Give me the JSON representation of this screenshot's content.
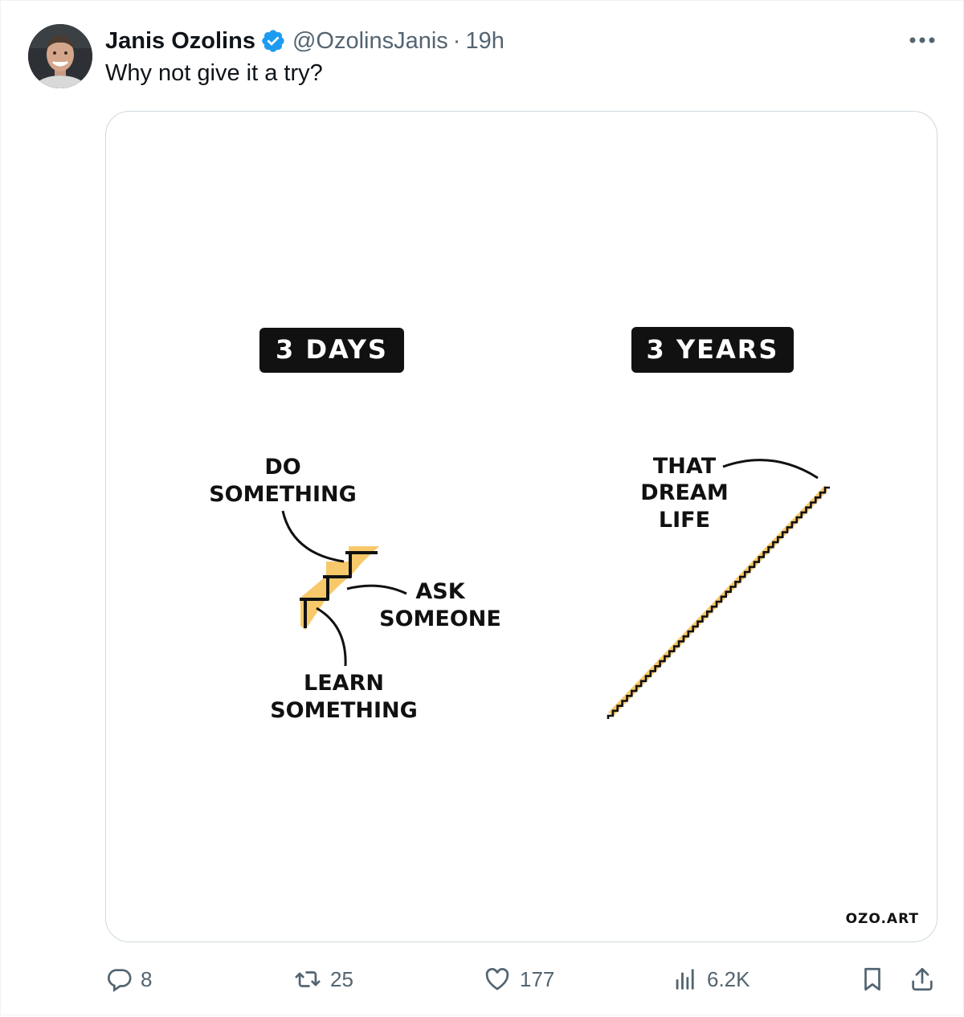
{
  "tweet": {
    "author_name": "Janis Ozolins",
    "handle": "@OzolinsJanis",
    "separator": "·",
    "time": "19h",
    "text": "Why not give it a try?"
  },
  "image": {
    "left_badge": "3 DAYS",
    "right_badge": "3 YEARS",
    "left_labels": {
      "do_something_line1": "DO",
      "do_something_line2": "SOMETHING",
      "ask_someone_line1": "ASK",
      "ask_someone_line2": "SOMEONE",
      "learn_something_line1": "LEARN",
      "learn_something_line2": "SOMETHING"
    },
    "right_labels": {
      "line1": "THAT",
      "line2": "DREAM",
      "line3": "LIFE"
    },
    "signature": "OZO.ART",
    "accent_color": "#f7c96b"
  },
  "actions": {
    "replies": "8",
    "retweets": "25",
    "likes": "177",
    "views": "6.2K"
  },
  "icons": {
    "verified": "verified-badge-icon",
    "more": "more-icon",
    "reply": "reply-icon",
    "retweet": "retweet-icon",
    "like": "heart-icon",
    "views": "views-icon",
    "bookmark": "bookmark-icon",
    "share": "share-icon"
  },
  "colors": {
    "text_primary": "#0f1419",
    "text_secondary": "#536471",
    "verified_blue": "#1d9bf0",
    "border": "#cfd9de"
  }
}
